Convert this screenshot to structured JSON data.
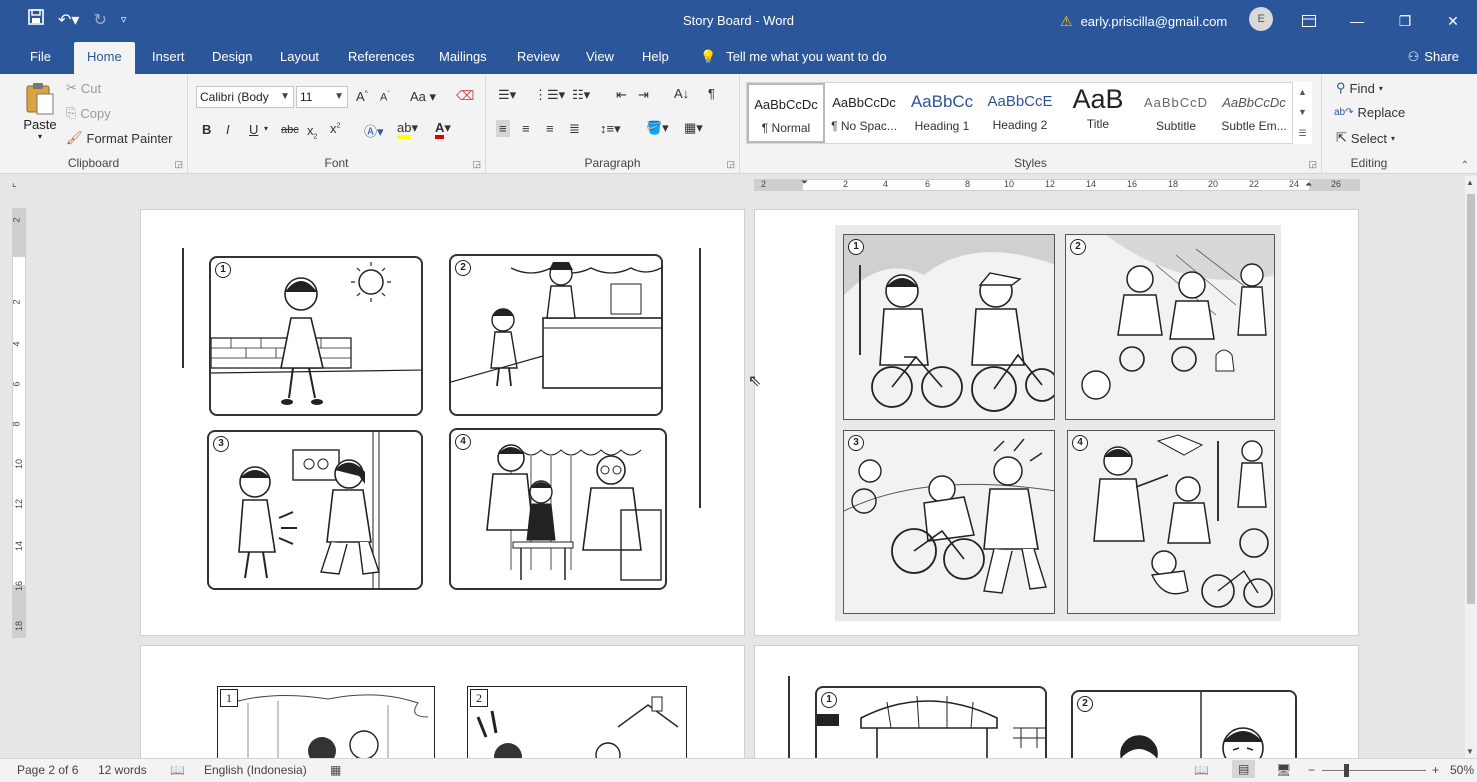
{
  "window": {
    "title": "Story Board  -  Word",
    "account": "early.priscilla@gmail.com",
    "avatar_initial": "E"
  },
  "tabs": [
    "File",
    "Home",
    "Insert",
    "Design",
    "Layout",
    "References",
    "Mailings",
    "Review",
    "View",
    "Help"
  ],
  "tell_me": "Tell me what you want to do",
  "share": "Share",
  "clipboard": {
    "paste": "Paste",
    "cut": "Cut",
    "copy": "Copy",
    "format_painter": "Format Painter",
    "label": "Clipboard"
  },
  "font": {
    "name": "Calibri (Body",
    "size": "11",
    "change_case": "Aa",
    "strike": "abc",
    "label": "Font"
  },
  "paragraph": {
    "label": "Paragraph"
  },
  "styles": {
    "label": "Styles",
    "items": [
      {
        "sample": "AaBbCcDc",
        "name": "¶ Normal"
      },
      {
        "sample": "AaBbCcDc",
        "name": "¶ No Spac..."
      },
      {
        "sample": "AaBbCc",
        "name": "Heading 1"
      },
      {
        "sample": "AaBbCcE",
        "name": "Heading 2"
      },
      {
        "sample": "AaB",
        "name": "Title"
      },
      {
        "sample": "AaBbCcD",
        "name": "Subtitle"
      },
      {
        "sample": "AaBbCcDc",
        "name": "Subtle Em..."
      }
    ]
  },
  "editing": {
    "find": "Find",
    "replace": "Replace",
    "select": "Select",
    "label": "Editing"
  },
  "ruler": {
    "h_ticks": [
      "2",
      "2",
      "4",
      "6",
      "8",
      "10",
      "12",
      "14",
      "16",
      "18",
      "20",
      "22",
      "24",
      "26"
    ],
    "v_ticks": [
      "2",
      "2",
      "4",
      "6",
      "8",
      "10",
      "12",
      "14",
      "16",
      "18"
    ]
  },
  "pages": {
    "p1_nums": [
      "1",
      "2",
      "3",
      "4"
    ],
    "p2_nums": [
      "1",
      "2",
      "3",
      "4"
    ],
    "p3_nums": [
      "1",
      "2"
    ],
    "p4_nums": [
      "1",
      "2"
    ]
  },
  "status": {
    "page": "Page 2 of 6",
    "words": "12 words",
    "language": "English (Indonesia)",
    "zoom": "50%"
  }
}
